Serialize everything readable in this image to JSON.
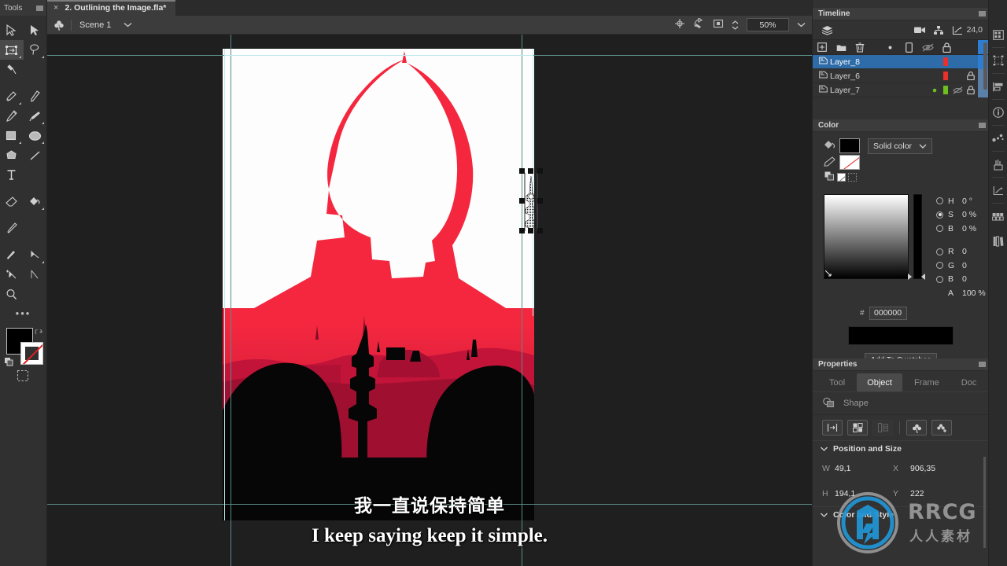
{
  "app": {
    "tools_panel_title": "Tools",
    "document_tab": "2. Outlining the Image.fla*",
    "close_tab_glyph": "×"
  },
  "scenebar": {
    "scene_name": "Scene 1",
    "chevron": "⌄",
    "zoom_value": "50%",
    "zoom_chevron": "⌄",
    "icons": [
      "clubs-symbol-icon",
      "center-stage-icon",
      "clip-content-icon",
      "stage-crop-icon"
    ]
  },
  "tools": {
    "items": [
      {
        "name": "selection-tool",
        "label": "Selection"
      },
      {
        "name": "subselection-tool",
        "label": "Subselection"
      },
      {
        "name": "free-transform-tool",
        "label": "Free Transform"
      },
      {
        "name": "lasso-tool",
        "label": "Lasso"
      },
      {
        "name": "asset-warp-tool",
        "label": "Asset Warp"
      },
      {
        "name": "paint-brush-tool",
        "label": "Paint Brush"
      },
      {
        "name": "brush-tool",
        "label": "Brush"
      },
      {
        "name": "pencil-tool",
        "label": "Pencil"
      },
      {
        "name": "classic-brush-tool",
        "label": "Classic Brush"
      },
      {
        "name": "rectangle-tool",
        "label": "Rectangle"
      },
      {
        "name": "oval-tool",
        "label": "Oval"
      },
      {
        "name": "polygon-tool",
        "label": "PolyStar"
      },
      {
        "name": "line-tool",
        "label": "Line"
      },
      {
        "name": "text-tool",
        "label": "Text"
      },
      {
        "name": "eraser-tool",
        "label": "Eraser"
      },
      {
        "name": "paint-bucket-tool",
        "label": "Paint Bucket"
      },
      {
        "name": "eyedropper-tool",
        "label": "Eyedropper"
      },
      {
        "name": "ink-bottle-tool",
        "label": "Ink Bottle"
      },
      {
        "name": "bone-tool",
        "label": "Bone"
      },
      {
        "name": "add-anchor-tool",
        "label": "Add Anchor Point"
      },
      {
        "name": "width-tool",
        "label": "Width"
      },
      {
        "name": "zoom-tool",
        "label": "Zoom"
      }
    ],
    "more_glyph": "•••",
    "fill_color": "#000000",
    "stroke_color": "none",
    "swatch_names": [
      "fill-color-swatch",
      "stroke-color-swatch",
      "swap-colors-icon",
      "reset-colors-icon"
    ]
  },
  "timeline": {
    "title": "Timeline",
    "frame_rate": "24,0",
    "toolbar_icons": [
      "layer-depth-icon",
      "camera-icon",
      "layer-parenting-icon",
      "graph-editor-icon"
    ],
    "layer_toolbar_icons": [
      "new-layer-icon",
      "new-folder-icon",
      "delete-layer-icon",
      "outline-dot-icon",
      "layer-type-icon",
      "hide-layers-icon",
      "lock-layers-icon"
    ],
    "layers": [
      {
        "name": "Layer_8",
        "selected": true,
        "marker_color": "#e8302c",
        "locked": false,
        "hidden": false,
        "dot": false
      },
      {
        "name": "Layer_6",
        "selected": false,
        "marker_color": "#e8302c",
        "locked": true,
        "hidden": false,
        "dot": false
      },
      {
        "name": "Layer_7",
        "selected": false,
        "marker_color": "#6fc01e",
        "locked": true,
        "hidden": true,
        "dot": true
      }
    ]
  },
  "color_panel": {
    "title": "Color",
    "fill_type": "Solid color",
    "fill_type_chevron": "⌄",
    "values": [
      {
        "label": "H",
        "value": "0 °",
        "radio": false
      },
      {
        "label": "S",
        "value": "0 %",
        "radio": true
      },
      {
        "label": "B",
        "value": "0 %",
        "radio": false
      },
      {
        "label": "R",
        "value": "0",
        "radio": false
      },
      {
        "label": "G",
        "value": "0",
        "radio": false
      },
      {
        "label": "B",
        "value": "0",
        "radio": false
      },
      {
        "label": "A",
        "value": "100 %",
        "radio": null
      }
    ],
    "hex_prefix": "#",
    "hex_value": "000000",
    "preview_color": "#000000",
    "add_to_swatches": "Add To Swatches"
  },
  "properties": {
    "title": "Properties",
    "tabs": [
      {
        "label": "Tool",
        "active": false
      },
      {
        "label": "Object",
        "active": true
      },
      {
        "label": "Frame",
        "active": false
      },
      {
        "label": "Doc",
        "active": false
      }
    ],
    "object_type": "Shape",
    "action_icons": [
      "align-icon",
      "distribute-icon",
      "match-size-icon",
      "convert-to-symbol-icon",
      "add-motion-tween-icon"
    ],
    "sections": [
      {
        "label": "Position and Size",
        "expanded": true
      },
      {
        "label": "Color and Style",
        "expanded": true
      }
    ],
    "fields": [
      {
        "label": "W",
        "value": "49,1",
        "label2": "X",
        "value2": "906,35"
      },
      {
        "label": "H",
        "value": "194,1",
        "label2": "Y",
        "value2": "222"
      }
    ],
    "collapse_chevron": "⌄"
  },
  "icon_rail": {
    "items": [
      "properties-panel-icon",
      "transform-panel-icon",
      "align-panel-icon",
      "info-panel-icon",
      "components-panel-icon",
      "actions-panel-icon",
      "graph-panel-icon",
      "frame-picker-icon",
      "library-panel-icon"
    ]
  },
  "stage": {
    "artwork_name": "red-droid-silhouette-artwork",
    "artwork_colors": {
      "bright_red": "#f4273f",
      "mid_red": "#e31b3d",
      "dark_red": "#b81338",
      "deeper_red": "#9e0f30",
      "black": "#060606",
      "canvas": "#fdfdfd"
    },
    "guide_color": "#5a8d87",
    "ruler_guide_color": "#bfe9ef",
    "selection_name": "selected-tower-shape"
  },
  "subtitles": {
    "chinese": "我一直说保持简单",
    "english": "I keep saying keep it simple."
  },
  "watermark": {
    "text": "RRCG",
    "subtext": "人人素材",
    "logo_color": "#2196d6"
  }
}
